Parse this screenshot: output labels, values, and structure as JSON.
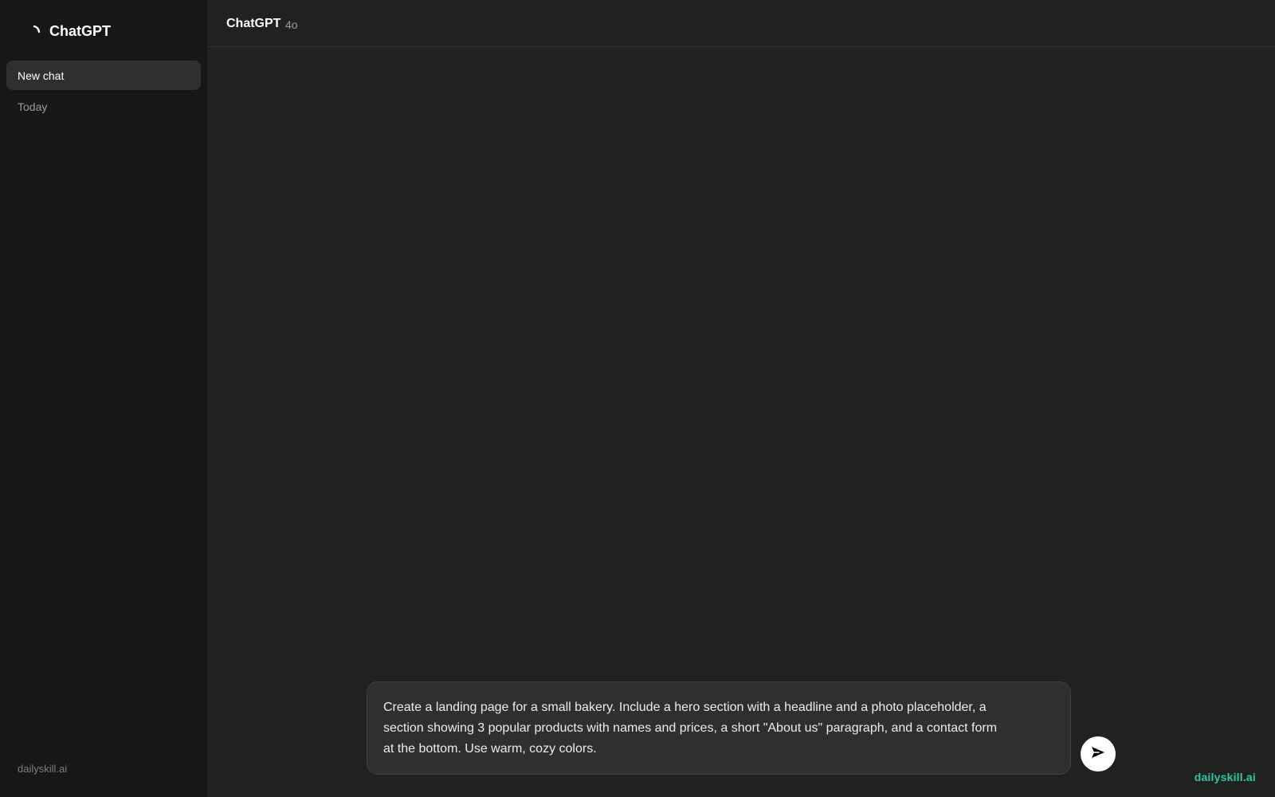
{
  "sidebar": {
    "brand_name": "ChatGPT",
    "logo_icon": "loading-spinner-icon",
    "new_chat_label": "New chat",
    "section_today": "Today",
    "footer_text": "dailyskill.ai"
  },
  "header": {
    "title": "ChatGPT",
    "model_version": "4o"
  },
  "composer": {
    "text": "Create a landing page for a small bakery. Include a hero section with a headline and a photo placeholder, a\nsection showing 3 popular products with names and prices, a short \"About us\" paragraph, and a contact form\nat the bottom. Use warm, cozy colors.",
    "send_icon": "send-icon"
  },
  "watermark": "dailyskill.ai",
  "colors": {
    "sidebar_bg": "#171717",
    "main_bg": "#212121",
    "composer_bg": "#2f2f2f",
    "accent": "#2fc7a6"
  }
}
